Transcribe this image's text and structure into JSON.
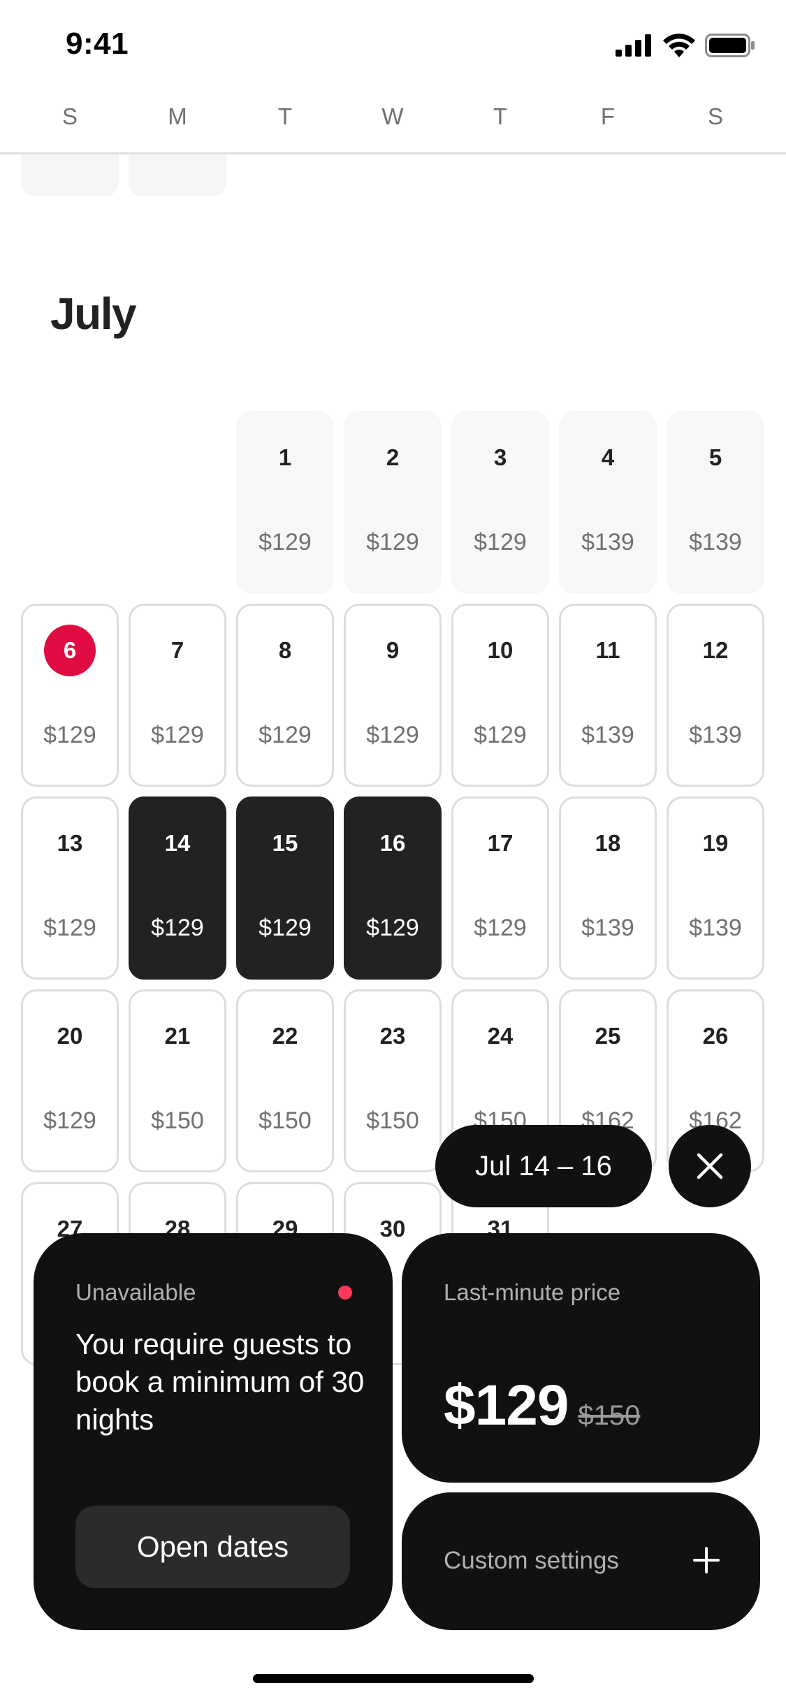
{
  "status_bar": {
    "time": "9:41"
  },
  "weekdays": [
    "S",
    "M",
    "T",
    "W",
    "T",
    "F",
    "S"
  ],
  "calendar": {
    "month": "July",
    "days": [
      {
        "day": "1",
        "price": "$129",
        "state": "past"
      },
      {
        "day": "2",
        "price": "$129",
        "state": "past"
      },
      {
        "day": "3",
        "price": "$129",
        "state": "past"
      },
      {
        "day": "4",
        "price": "$139",
        "state": "past"
      },
      {
        "day": "5",
        "price": "$139",
        "state": "past"
      },
      {
        "day": "6",
        "price": "$129",
        "state": "today"
      },
      {
        "day": "7",
        "price": "$129",
        "state": "normal"
      },
      {
        "day": "8",
        "price": "$129",
        "state": "normal"
      },
      {
        "day": "9",
        "price": "$129",
        "state": "normal"
      },
      {
        "day": "10",
        "price": "$129",
        "state": "normal"
      },
      {
        "day": "11",
        "price": "$139",
        "state": "normal"
      },
      {
        "day": "12",
        "price": "$139",
        "state": "normal"
      },
      {
        "day": "13",
        "price": "$129",
        "state": "normal"
      },
      {
        "day": "14",
        "price": "$129",
        "state": "selected"
      },
      {
        "day": "15",
        "price": "$129",
        "state": "selected"
      },
      {
        "day": "16",
        "price": "$129",
        "state": "selected"
      },
      {
        "day": "17",
        "price": "$129",
        "state": "normal"
      },
      {
        "day": "18",
        "price": "$139",
        "state": "normal"
      },
      {
        "day": "19",
        "price": "$139",
        "state": "normal"
      },
      {
        "day": "20",
        "price": "$129",
        "state": "normal"
      },
      {
        "day": "21",
        "price": "$150",
        "state": "normal"
      },
      {
        "day": "22",
        "price": "$150",
        "state": "normal"
      },
      {
        "day": "23",
        "price": "$150",
        "state": "normal"
      },
      {
        "day": "24",
        "price": "$150",
        "state": "normal"
      },
      {
        "day": "25",
        "price": "$162",
        "state": "normal"
      },
      {
        "day": "26",
        "price": "$162",
        "state": "normal"
      },
      {
        "day": "27",
        "price": "",
        "state": "normal"
      },
      {
        "day": "28",
        "price": "",
        "state": "normal"
      },
      {
        "day": "29",
        "price": "",
        "state": "normal"
      },
      {
        "day": "30",
        "price": "",
        "state": "normal"
      },
      {
        "day": "31",
        "price": "",
        "state": "normal"
      }
    ]
  },
  "selection": {
    "range_label": "Jul 14 – 16"
  },
  "unavailable_panel": {
    "label": "Unavailable",
    "message": "You require guests to book a minimum of 30 nights",
    "button_label": "Open dates"
  },
  "price_panel": {
    "label": "Last-minute price",
    "current_price": "$129",
    "original_price": "$150"
  },
  "custom_panel": {
    "label": "Custom settings"
  },
  "colors": {
    "accent": "#e00b41",
    "selected": "#222222",
    "panel": "#111111"
  },
  "icons": [
    "signal-icon",
    "wifi-icon",
    "battery-icon",
    "close-icon",
    "plus-icon"
  ]
}
